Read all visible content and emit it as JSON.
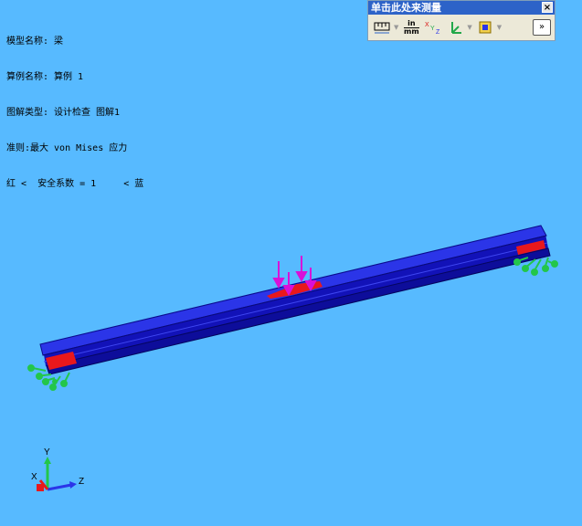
{
  "info_lines": [
    "模型名称: 梁",
    "算例名称: 算例 1",
    "图解类型: 设计检查 图解1",
    "准则:最大 von Mises 应力",
    "红 <  安全系数 = 1     < 蓝"
  ],
  "measure_toolbar": {
    "title": "单击此处来测量",
    "close": "×",
    "units_top": "in",
    "units_bottom": "mm",
    "expand": "»"
  },
  "triad": {
    "x_label": "X",
    "y_label": "Y",
    "z_label": "Z"
  },
  "colors": {
    "background": "#57baff",
    "beam": "#1c1cd6",
    "beam_dark": "#0a0a8c",
    "beam_top": "#2b35e8",
    "critical_region": "#e8181c",
    "fixture": "#23c64a",
    "load_arrow": "#d810d8",
    "title_bar": "#2d63c8",
    "toolbar_bg": "#ece9d8"
  },
  "icons": [
    "measure-icon",
    "units-icon",
    "xyz-icon",
    "delta-axes-icon",
    "point-icon"
  ]
}
